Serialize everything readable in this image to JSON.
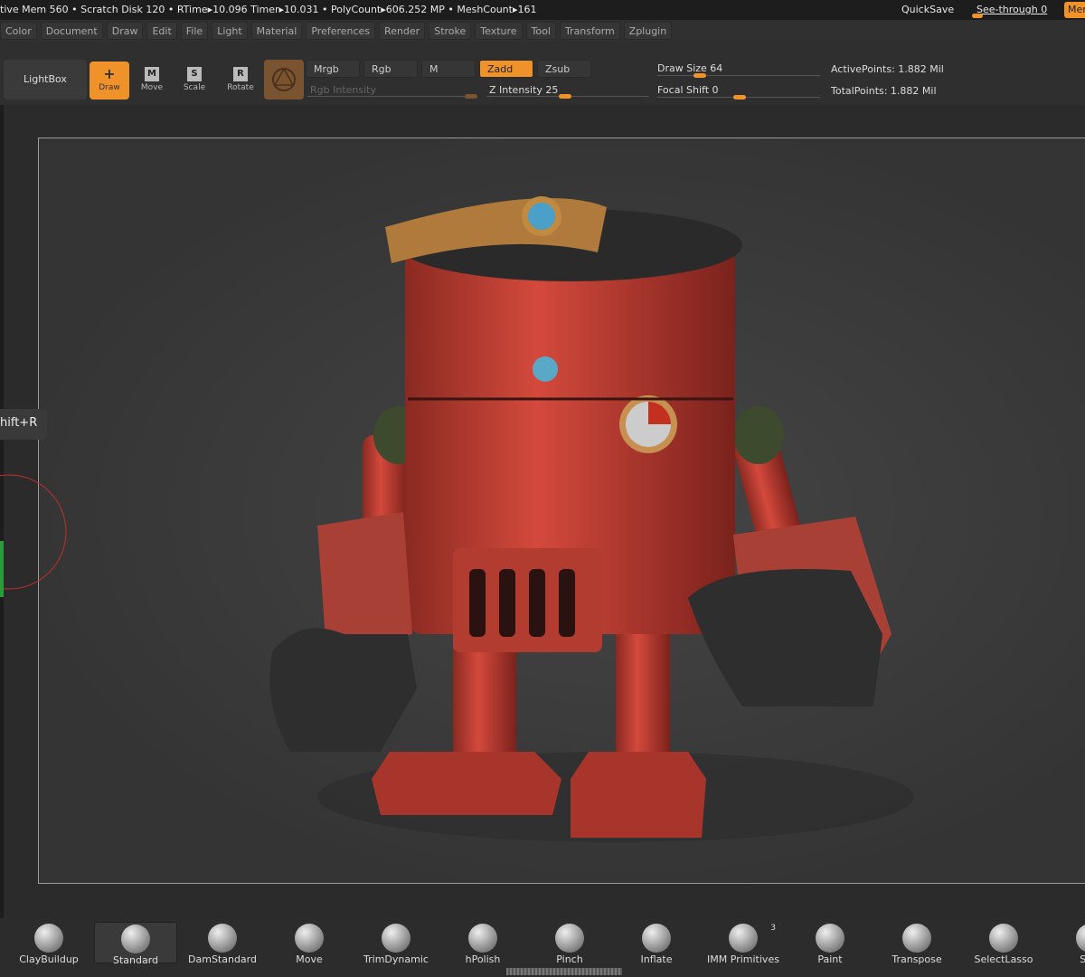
{
  "status": {
    "stats": "tive Mem 560 • Scratch Disk 120 •  RTime▸10.096 Timer▸10.031 • PolyCount▸606.252 MP  • MeshCount▸161",
    "quicksave": "QuickSave",
    "see_through": "See-through  0",
    "see_through_value": 0,
    "menus_btn": "Menus"
  },
  "menus": [
    "Color",
    "Document",
    "Draw",
    "Edit",
    "File",
    "Light",
    "Material",
    "Preferences",
    "Render",
    "Stroke",
    "Texture",
    "Tool",
    "Transform",
    "Zplugin"
  ],
  "toolbar": {
    "lightbox": "LightBox",
    "draw": "Draw",
    "move": "Move",
    "scale": "Scale",
    "rotate": "Rotate",
    "move_key": "M",
    "scale_key": "S",
    "rotate_key": "R",
    "mrgb": "Mrgb",
    "rgb": "Rgb",
    "m": "M",
    "zadd": "Zadd",
    "zsub": "Zsub",
    "rgb_intensity": "Rgb Intensity",
    "z_intensity": "Z Intensity 25",
    "draw_size": "Draw Size 64",
    "focal_shift": "Focal Shift 0",
    "active_points": "ActivePoints: 1.882 Mil",
    "total_points": "TotalPoints: 1.882 Mil",
    "accent": "#f0922a"
  },
  "tooltip": "hift+R",
  "brushes": [
    {
      "label": "ClayBuildup"
    },
    {
      "label": "Standard",
      "selected": true
    },
    {
      "label": "DamStandard"
    },
    {
      "label": "Move"
    },
    {
      "label": "TrimDynamic"
    },
    {
      "label": "hPolish"
    },
    {
      "label": "Pinch"
    },
    {
      "label": "Inflate"
    },
    {
      "label": "IMM Primitives",
      "count": "3"
    },
    {
      "label": "Paint"
    },
    {
      "label": "Transpose"
    },
    {
      "label": "SelectLasso"
    },
    {
      "label": "Sele"
    }
  ]
}
